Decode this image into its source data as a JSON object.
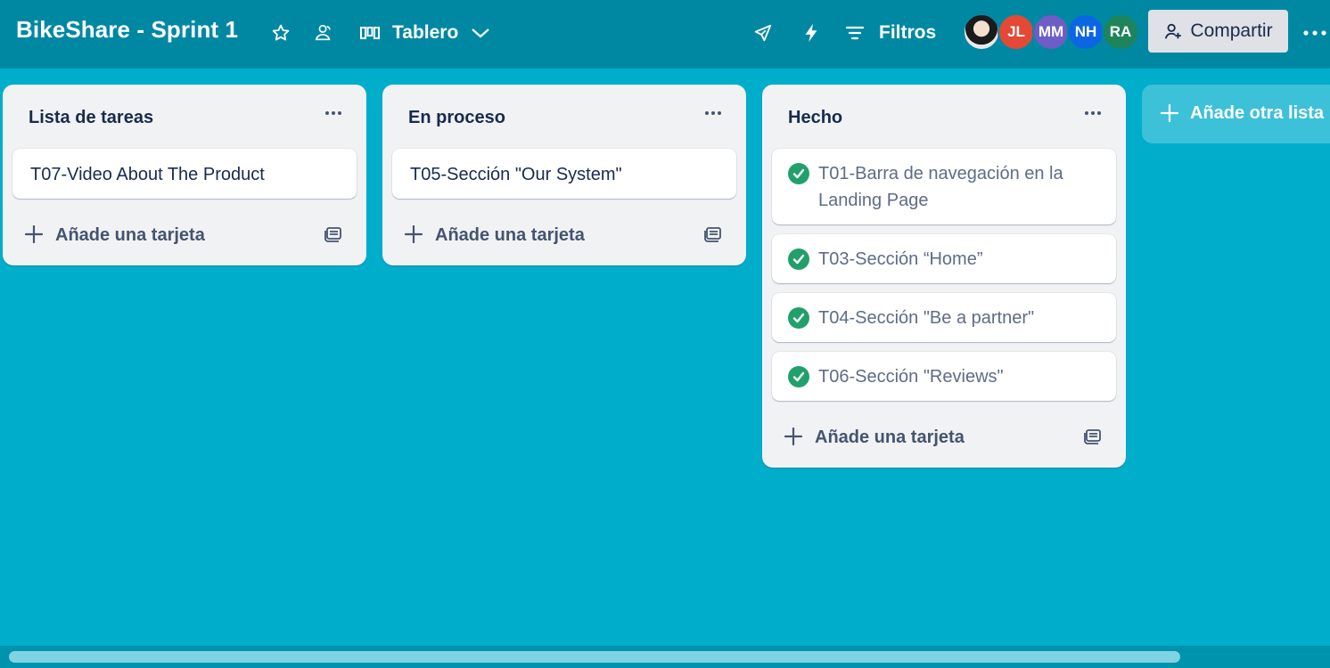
{
  "header": {
    "board_title": "BikeShare - Sprint 1",
    "view_label": "Tablero",
    "filters_label": "Filtros",
    "share_label": "Compartir",
    "members": [
      {
        "initials": "",
        "color": "#e9e9e9",
        "icon": "user-photo-avatar"
      },
      {
        "initials": "JL",
        "color": "#e34935"
      },
      {
        "initials": "MM",
        "color": "#6e5dc6"
      },
      {
        "initials": "NH",
        "color": "#0c66e4"
      },
      {
        "initials": "RA",
        "color": "#1f845a"
      }
    ]
  },
  "lists": [
    {
      "title": "Lista de tareas",
      "cards": [
        {
          "text": "T07-Video About The Product"
        }
      ],
      "add_card_label": "Añade una tarjeta"
    },
    {
      "title": "En proceso",
      "cards": [
        {
          "text": "T05-Sección \"Our System\""
        }
      ],
      "add_card_label": "Añade una tarjeta"
    },
    {
      "title": "Hecho",
      "cards": [
        {
          "text": "T01-Barra de navegación en la Landing Page",
          "done": true
        },
        {
          "text": "T03-Sección “Home”",
          "done": true
        },
        {
          "text": "T04-Sección \"Be a partner\"",
          "done": true
        },
        {
          "text": "T06-Sección \"Reviews\"",
          "done": true
        }
      ],
      "add_card_label": "Añade una tarjeta"
    }
  ],
  "add_list_label": "Añade otra lista",
  "colors": {
    "board_background": "#00aecc",
    "header_background": "#0088a3",
    "list_background": "#f1f2f4",
    "done_check": "#22a06b"
  }
}
